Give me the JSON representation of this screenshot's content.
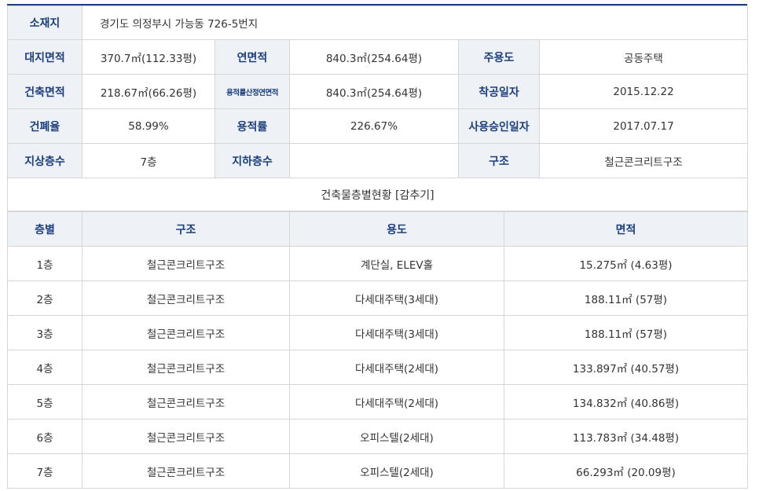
{
  "building": {
    "address_label": "소재지",
    "address_value": "경기도 의정부시 가능동 726-5번지",
    "site_area_label": "대지면적",
    "site_area_value": "370.7㎡(112.33평)",
    "total_floor_area_label": "연면적",
    "total_floor_area_value": "840.3㎡(254.64평)",
    "main_use_label": "주용도",
    "main_use_value": "공동주택",
    "building_area_label": "건축면적",
    "building_area_value": "218.67㎡(66.26평)",
    "far_floor_area_label": "용적률산정연면적",
    "far_floor_area_value": "840.3㎡(254.64평)",
    "construction_start_label": "착공일자",
    "construction_start_value": "2015.12.22",
    "coverage_ratio_label": "건폐율",
    "coverage_ratio_value": "58.99%",
    "floor_area_ratio_label": "용적률",
    "floor_area_ratio_value": "226.67%",
    "approval_date_label": "사용승인일자",
    "approval_date_value": "2017.07.17",
    "above_floors_label": "지상층수",
    "above_floors_value": "7층",
    "below_floors_label": "지하층수",
    "below_floors_value": "",
    "structure_label": "구조",
    "structure_value": "철근콘크리트구조"
  },
  "floor_section": {
    "title": "건축물층별현황 [감추기]"
  },
  "floor_table": {
    "headers": [
      "층별",
      "구조",
      "용도",
      "면적"
    ],
    "rows": [
      [
        "1층",
        "철근콘크리트구조",
        "계단실, ELEV홀",
        "15.275㎡ (4.63평)"
      ],
      [
        "2층",
        "철근콘크리트구조",
        "다세대주택(3세대)",
        "188.11㎡ (57평)"
      ],
      [
        "3층",
        "철근콘크리트구조",
        "다세대주택(3세대)",
        "188.11㎡ (57평)"
      ],
      [
        "4층",
        "철근콘크리트구조",
        "다세대주택(2세대)",
        "133.897㎡ (40.57평)"
      ],
      [
        "5층",
        "철근콘크리트구조",
        "다세대주택(2세대)",
        "134.832㎡ (40.86평)"
      ],
      [
        "6층",
        "철근콘크리트구조",
        "오피스텔(2세대)",
        "113.783㎡ (34.48평)"
      ],
      [
        "7층",
        "철근콘크리트구조",
        "오피스텔(2세대)",
        "66.293㎡ (20.09평)"
      ]
    ]
  }
}
